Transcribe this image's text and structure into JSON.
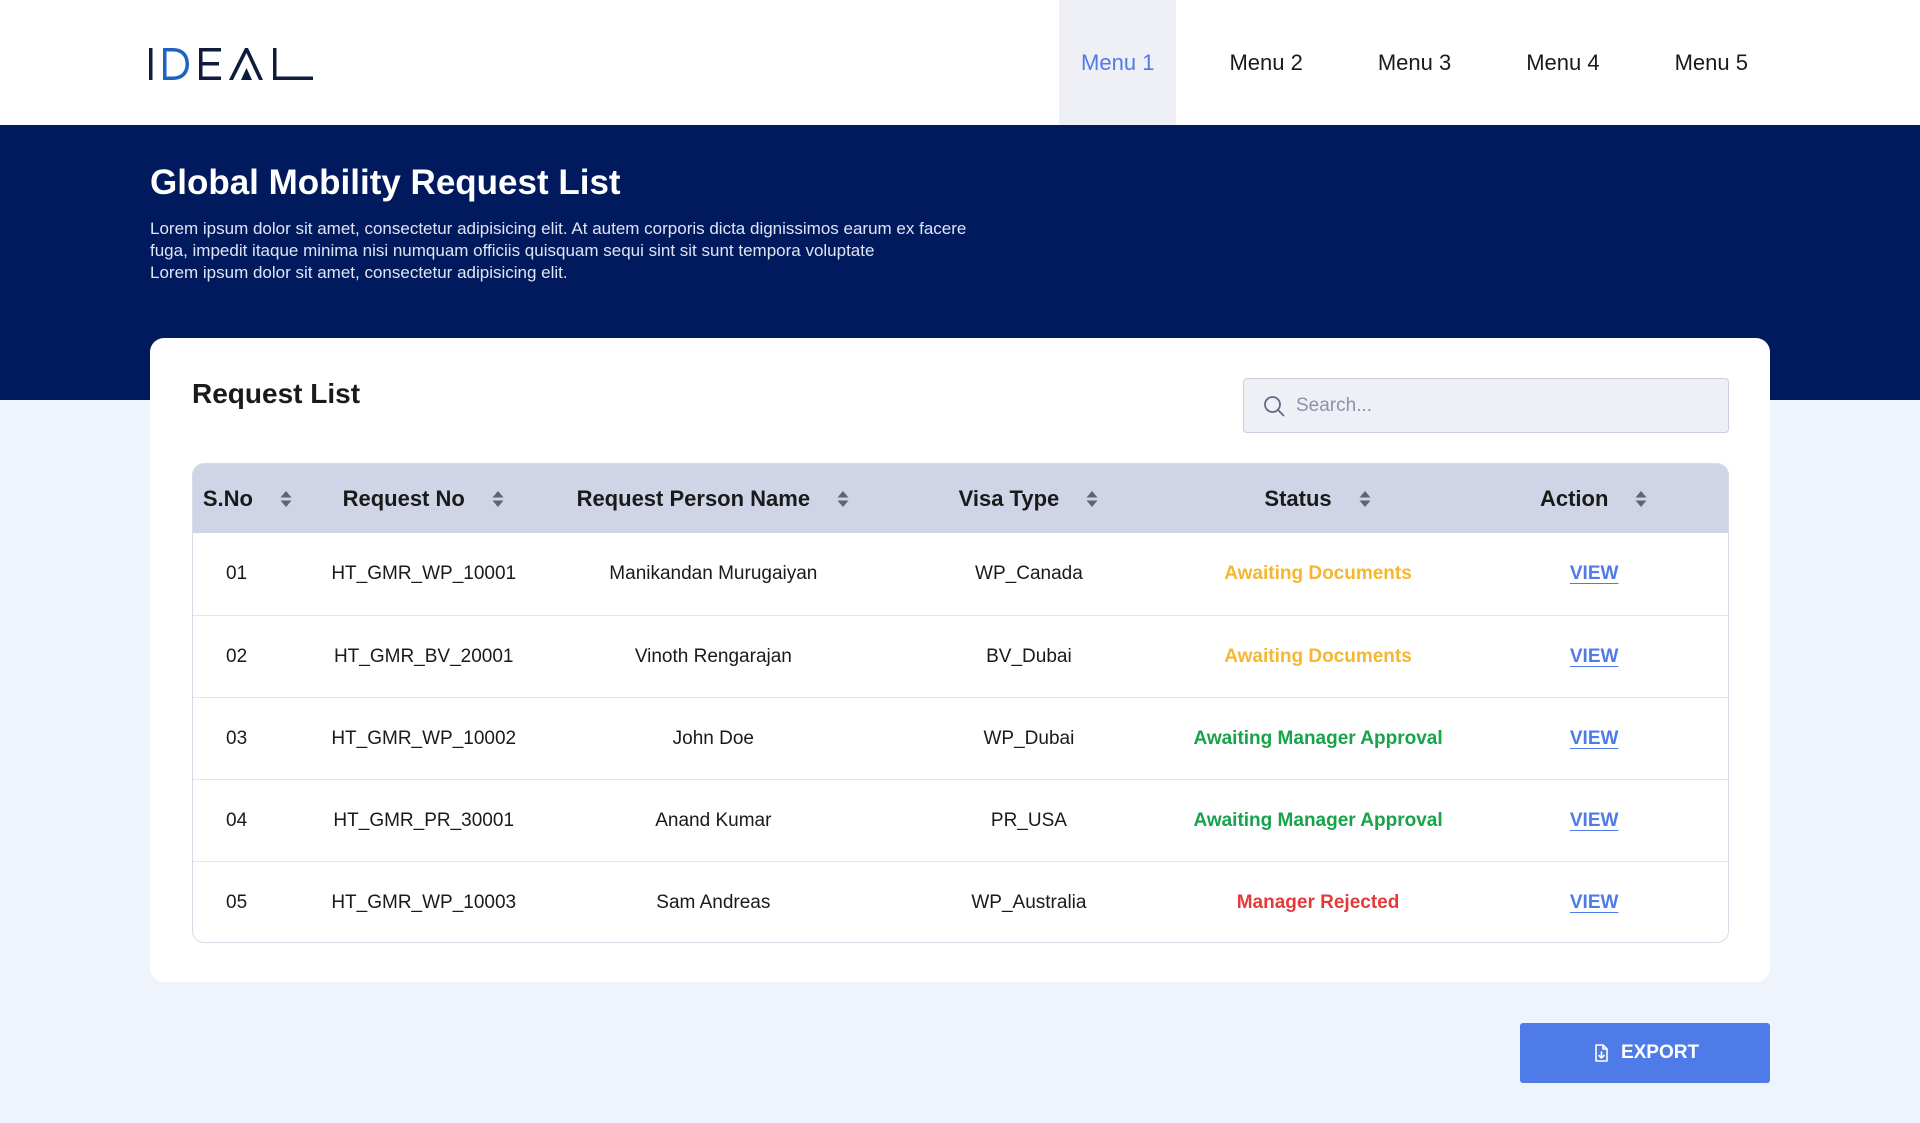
{
  "brand": {
    "logo_text": "IDEAL"
  },
  "nav": {
    "items": [
      {
        "label": "Menu 1",
        "active": true
      },
      {
        "label": "Menu 2",
        "active": false
      },
      {
        "label": "Menu 3",
        "active": false
      },
      {
        "label": "Menu 4",
        "active": false
      },
      {
        "label": "Menu 5",
        "active": false
      }
    ]
  },
  "hero": {
    "title": "Global Mobility Request List",
    "description": [
      "Lorem ipsum dolor sit amet, consectetur adipisicing elit. At autem corporis dicta dignissimos earum ex facere",
      "fuga, impedit itaque minima nisi numquam officiis quisquam sequi sint sit sunt tempora voluptate",
      "Lorem ipsum dolor sit amet, consectetur adipisicing elit."
    ]
  },
  "card": {
    "title": "Request List",
    "search": {
      "placeholder": "Search...",
      "value": ""
    }
  },
  "table": {
    "columns": [
      "S.No",
      "Request No",
      "Request Person Name",
      "Visa Type",
      "Status",
      "Action"
    ],
    "rows": [
      {
        "sno": "01",
        "request_no": "HT_GMR_WP_10001",
        "name": "Manikandan Murugaiyan",
        "visa": "WP_Canada",
        "status": "Awaiting Documents",
        "action": "VIEW"
      },
      {
        "sno": "02",
        "request_no": "HT_GMR_BV_20001",
        "name": "Vinoth Rengarajan",
        "visa": "BV_Dubai",
        "status": "Awaiting Documents",
        "action": "VIEW"
      },
      {
        "sno": "03",
        "request_no": "HT_GMR_WP_10002",
        "name": "John Doe",
        "visa": "WP_Dubai",
        "status": "Awaiting Manager Approval",
        "action": "VIEW"
      },
      {
        "sno": "04",
        "request_no": "HT_GMR_PR_30001",
        "name": "Anand Kumar",
        "visa": "PR_USA",
        "status": "Awaiting Manager Approval",
        "action": "VIEW"
      },
      {
        "sno": "05",
        "request_no": "HT_GMR_WP_10003",
        "name": "Sam Andreas",
        "visa": "WP_Australia",
        "status": "Manager Rejected",
        "action": "VIEW"
      }
    ]
  },
  "export": {
    "label": "EXPORT"
  },
  "colors": {
    "hero_bg": "#011a5e",
    "accent": "#4f7be8",
    "status_awaiting_documents": "#f5b731",
    "status_awaiting_approval": "#16a34a",
    "status_rejected": "#e33a3a"
  },
  "icons": {
    "search": "search-icon",
    "sort": "sort-icon",
    "export": "file-export-icon"
  }
}
